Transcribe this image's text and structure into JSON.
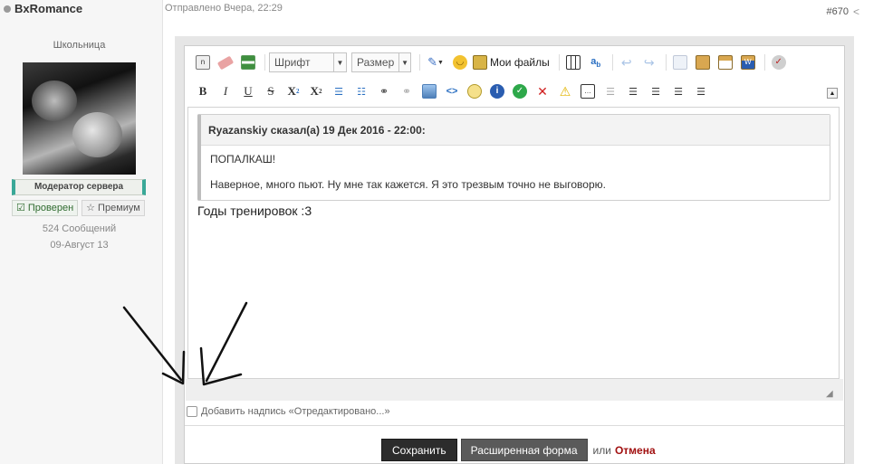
{
  "user": {
    "name": "BxRomance",
    "title": "Школьница",
    "moderator_badge": "Модератор сервера",
    "verified_label": "Проверен",
    "premium_label": "Премиум",
    "message_count": "524 Сообщений",
    "join_date": "09-Август 13"
  },
  "post": {
    "sent_info": "Отправлено Вчера, 22:29",
    "number": "#670"
  },
  "toolbar": {
    "font_select": "Шрифт",
    "size_select": "Размер",
    "my_files": "Мои файлы",
    "bold": "B",
    "italic": "I",
    "underline": "U",
    "strike": "S",
    "subscript": "X",
    "subscript_mark": "2",
    "superscript": "X",
    "superscript_mark": "2",
    "icons_row1": [
      "source-icon",
      "eraser-icon",
      "background-icon",
      "style-icon",
      "smiley-icon",
      "myfiles-icon",
      "table-icon",
      "translate-icon",
      "undo-icon",
      "redo-icon",
      "copy-icon",
      "paste-icon",
      "paste-text-icon",
      "paste-word-icon",
      "spellcheck-icon"
    ],
    "icons_row2": [
      "bold-icon",
      "italic-icon",
      "underline-icon",
      "strike-icon",
      "subscript-icon",
      "superscript-icon",
      "bullet-list-icon",
      "numbered-list-icon",
      "link-icon",
      "unlink-icon",
      "image-icon",
      "code-icon",
      "quote-icon",
      "info-icon",
      "check-icon",
      "cross-icon",
      "warning-icon",
      "spoiler-icon",
      "outdent-icon",
      "indent-icon",
      "align-left-icon",
      "align-center-icon",
      "align-right-icon"
    ]
  },
  "editor": {
    "quote_header": "Ryazanskiy сказал(а) 19 Дек 2016 - 22:00:",
    "quote_line1": "ПОПАЛКАШ!",
    "quote_line2": "Наверное, много пьют. Ну мне так кажется. Я это трезвым точно не выговорю.",
    "body_text": "Годы тренировок :3"
  },
  "form": {
    "edit_notice_label": "Добавить надпись «Отредактировано...»",
    "save_button": "Сохранить",
    "advanced_button": "Расширенная форма",
    "or_text": "или",
    "cancel_link": "Отмена"
  },
  "colors": {
    "accent_teal": "#3aa898",
    "cancel_red": "#a11010",
    "save_dark": "#2c2c2c"
  }
}
